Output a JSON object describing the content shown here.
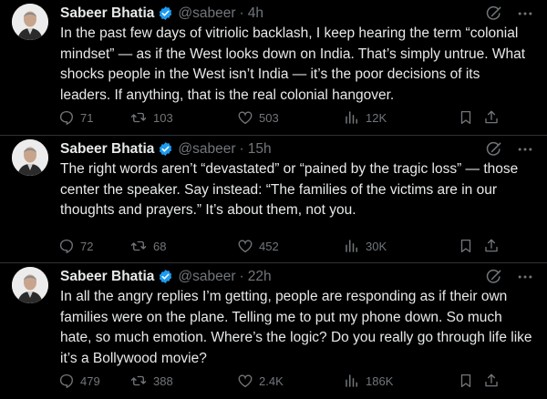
{
  "colors": {
    "background": "#000000",
    "text": "#e7e9ea",
    "muted": "#71767b",
    "verified": "#1d9bf0",
    "divider": "#2f3336"
  },
  "icons": {
    "verified": "verified-badge-icon",
    "grok": "grok-icon",
    "more": "more-icon",
    "reply": "reply-icon",
    "retweet": "retweet-icon",
    "like": "like-icon",
    "views": "views-icon",
    "bookmark": "bookmark-icon",
    "share": "share-icon"
  },
  "tweets": [
    {
      "author": "Sabeer Bhatia",
      "handle": "@sabeer",
      "dot": "·",
      "time": "4h",
      "text": "In the past few days of vitriolic backlash, I keep hearing the term “colonial\nmindset” — as if the West looks down on India. That’s simply untrue. What\nshocks people in the West isn’t India — it’s the poor decisions of its\nleaders. If anything, that is the real colonial hangover.",
      "replies": "71",
      "retweets": "103",
      "likes": "503",
      "views": "12K"
    },
    {
      "author": "Sabeer Bhatia",
      "handle": "@sabeer",
      "dot": "·",
      "time": "15h",
      "text": "The right words aren’t “devastated” or “pained by the tragic loss” — those\ncenter the speaker. Say instead: “The families of the victims are in our\nthoughts and prayers.” It’s about them, not you.",
      "replies": "72",
      "retweets": "68",
      "likes": "452",
      "views": "30K"
    },
    {
      "author": "Sabeer Bhatia",
      "handle": "@sabeer",
      "dot": "·",
      "time": "22h",
      "text": "In all the angry replies I’m getting, people are responding as if their own\nfamilies were on the plane. Telling me to put my phone down. So much\nhate, so much emotion. Where’s the logic? Do you really go through life like\nit’s a Bollywood movie?",
      "replies": "479",
      "retweets": "388",
      "likes": "2.4K",
      "views": "186K"
    }
  ]
}
